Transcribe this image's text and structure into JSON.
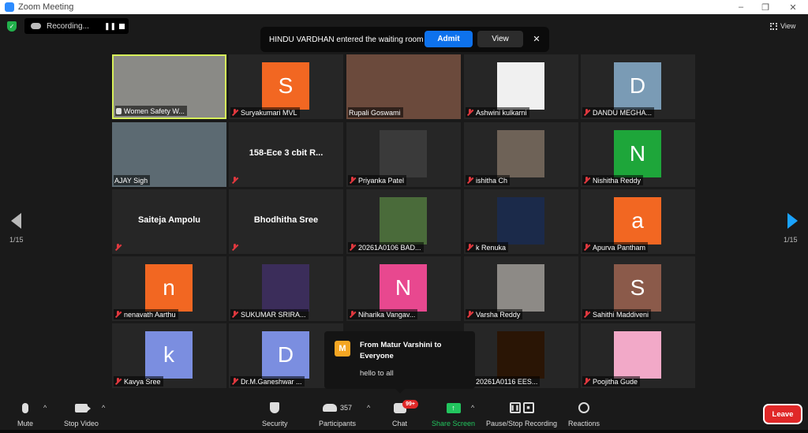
{
  "window": {
    "title": "Zoom Meeting",
    "minimize": "–",
    "maximize": "❐",
    "close": "✕"
  },
  "recording": {
    "label": "Recording...",
    "pause": "❚❚"
  },
  "waiting_notice": {
    "message": "HINDU VARDHAN entered the waiting room",
    "admit": "Admit",
    "view": "View",
    "close": "✕"
  },
  "view_button": {
    "label": "View"
  },
  "pagination": {
    "left": "1/15",
    "right": "1/15"
  },
  "participants": [
    {
      "name": "Women Safety W...",
      "type": "video",
      "active": true,
      "muted": false,
      "pinned": true,
      "bg": "#8a8a86"
    },
    {
      "name": "Suryakumari MVL",
      "type": "avatar",
      "letter": "S",
      "color": "#f26722",
      "muted": true
    },
    {
      "name": "Rupali Goswami",
      "type": "video",
      "muted": false,
      "bg": "#6b4a3c"
    },
    {
      "name": "Ashwini kulkarni",
      "type": "pic",
      "color": "#f0f0f0",
      "muted": true
    },
    {
      "name": "DANDU MEGHA...",
      "type": "avatar",
      "letter": "D",
      "color": "#7a9bb5",
      "muted": true
    },
    {
      "name": "AJAY Sigh",
      "type": "video",
      "muted": false,
      "bg": "#5c6a72"
    },
    {
      "name": "",
      "title": "158-Ece 3 cbit R...",
      "type": "name",
      "muted": true
    },
    {
      "name": "Priyanka Patel",
      "type": "pic",
      "color": "#3a3a3a",
      "muted": true
    },
    {
      "name": "ishitha Ch",
      "type": "pic",
      "color": "#6e6257",
      "muted": true
    },
    {
      "name": "Nishitha Reddy",
      "type": "avatar",
      "letter": "N",
      "color": "#1ea63a",
      "muted": true
    },
    {
      "name": "",
      "title": "Saiteja Ampolu",
      "type": "name",
      "muted": true
    },
    {
      "name": "",
      "title": "Bhodhitha Sree",
      "type": "name",
      "muted": true
    },
    {
      "name": "20261A0106 BAD...",
      "type": "pic",
      "color": "#4a6b3a",
      "muted": true
    },
    {
      "name": "k Renuka",
      "type": "pic",
      "color": "#1b2a4a",
      "muted": true
    },
    {
      "name": "Apurva Pantham",
      "type": "avatar",
      "letter": "a",
      "color": "#f26722",
      "muted": true
    },
    {
      "name": "nenavath Aarthu",
      "type": "avatar",
      "letter": "n",
      "color": "#f26722",
      "muted": true
    },
    {
      "name": "SUKUMAR SRIRA...",
      "type": "pic",
      "color": "#3b2d5a",
      "muted": true
    },
    {
      "name": "Niharika Vangav...",
      "type": "avatar",
      "letter": "N",
      "color": "#e8488f",
      "muted": true
    },
    {
      "name": "Varsha Reddy",
      "type": "pic",
      "color": "#8d8a86",
      "muted": true
    },
    {
      "name": "Sahithi Maddiveni",
      "type": "avatar",
      "letter": "S",
      "color": "#8b5a4a",
      "muted": true
    },
    {
      "name": "Kavya Sree",
      "type": "avatar",
      "letter": "k",
      "color": "#7b8ee0",
      "muted": true
    },
    {
      "name": "Dr.M.Ganeshwar ...",
      "type": "avatar",
      "letter": "D",
      "color": "#7b8ee0",
      "muted": true
    },
    {
      "name": "",
      "type": "hidden",
      "muted": false
    },
    {
      "name": "20261A0116 EES...",
      "type": "pic",
      "color": "#2a1505",
      "muted": true
    },
    {
      "name": "Poojitha Gude",
      "type": "pic",
      "color": "#f2a9c8",
      "muted": true
    }
  ],
  "chat_popup": {
    "avatar_letter": "M",
    "from": "From Matur Varshini to Everyone",
    "message": "hello to all"
  },
  "toolbar": {
    "mute": "Mute",
    "stop_video": "Stop Video",
    "security": "Security",
    "participants": "Participants",
    "participant_count": "357",
    "chat": "Chat",
    "chat_badge": "99+",
    "share_screen": "Share Screen",
    "recording": "Pause/Stop Recording",
    "reactions": "Reactions",
    "leave": "Leave",
    "caret": "^"
  },
  "colors": {
    "accent": "#0e72ed",
    "share": "#22c55e",
    "leave": "#e02828",
    "active_border": "#d7f05a"
  }
}
